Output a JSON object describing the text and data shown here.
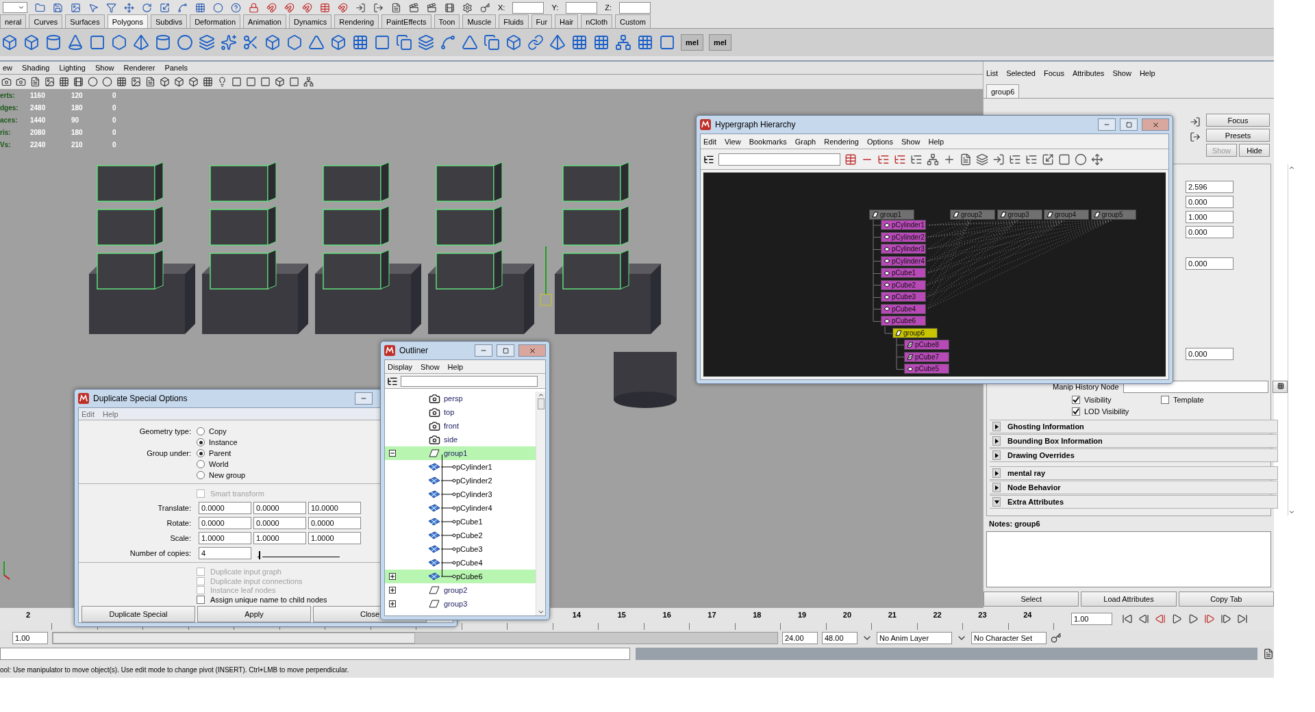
{
  "toolbar": {
    "coords": [
      "X:",
      "Y:",
      "Z:"
    ]
  },
  "shelf_tabs": [
    {
      "label": "neral",
      "selected": false
    },
    {
      "label": "Curves",
      "selected": false
    },
    {
      "label": "Surfaces",
      "selected": false
    },
    {
      "label": "Polygons",
      "selected": true
    },
    {
      "label": "Subdivs",
      "selected": false
    },
    {
      "label": "Deformation",
      "selected": false
    },
    {
      "label": "Animation",
      "selected": false
    },
    {
      "label": "Dynamics",
      "selected": false
    },
    {
      "label": "Rendering",
      "selected": false
    },
    {
      "label": "PaintEffects",
      "selected": false
    },
    {
      "label": "Toon",
      "selected": false
    },
    {
      "label": "Muscle",
      "selected": false
    },
    {
      "label": "Fluids",
      "selected": false
    },
    {
      "label": "Fur",
      "selected": false
    },
    {
      "label": "Hair",
      "selected": false
    },
    {
      "label": "nCloth",
      "selected": false
    },
    {
      "label": "Custom",
      "selected": false
    }
  ],
  "shelf_labels": [
    "mel",
    "mel"
  ],
  "panel_menu": [
    "ew",
    "Shading",
    "Lighting",
    "Show",
    "Renderer",
    "Panels"
  ],
  "hud": [
    {
      "label": "erts:",
      "values": [
        "1160",
        "120",
        "0"
      ]
    },
    {
      "label": "dges:",
      "values": [
        "2480",
        "180",
        "0"
      ]
    },
    {
      "label": "aces:",
      "values": [
        "1440",
        "90",
        "0"
      ]
    },
    {
      "label": "ris:",
      "values": [
        "2080",
        "180",
        "0"
      ]
    },
    {
      "label": "Vs:",
      "values": [
        "2240",
        "210",
        "0"
      ]
    }
  ],
  "attribute_editor": {
    "menus": [
      "List",
      "Selected",
      "Focus",
      "Attributes",
      "Show",
      "Help"
    ],
    "tabs": [
      {
        "label": "group6",
        "selected": true
      }
    ],
    "buttons": [
      {
        "label": "Focus",
        "disabled": false
      },
      {
        "label": "Presets",
        "disabled": false
      },
      {
        "label": "Show",
        "disabled": true
      },
      {
        "label": "Hide",
        "disabled": false
      }
    ],
    "fields": [
      "2.596",
      "0.000",
      "1.000",
      "0.000",
      "0.000",
      "0.000"
    ],
    "manip_label": "Manip History Node",
    "checks": [
      {
        "label": "Visibility",
        "checked": true
      },
      {
        "label": "Template",
        "checked": false
      },
      {
        "label": "LOD Visibility",
        "checked": true
      }
    ],
    "sections": [
      {
        "label": "Ghosting Information",
        "expanded": false
      },
      {
        "label": "Bounding Box Information",
        "expanded": false
      },
      {
        "label": "Drawing Overrides",
        "expanded": false
      },
      {
        "label": "mental ray",
        "expanded": false
      },
      {
        "label": "Node Behavior",
        "expanded": false
      },
      {
        "label": "Extra Attributes",
        "expanded": true
      }
    ],
    "notes": {
      "label": "Notes:  group6"
    },
    "bottom_buttons": [
      "Select",
      "Load Attributes",
      "Copy Tab"
    ]
  },
  "timeline": {
    "frames": [
      "2",
      "14",
      "15",
      "16",
      "17",
      "18",
      "19",
      "20",
      "21",
      "22",
      "23",
      "24"
    ],
    "current_frame": "1.00"
  },
  "range": {
    "start": "1.00",
    "end": "24.00",
    "max": "48.00",
    "anim_layer": "No Anim Layer",
    "character_set": "No Character Set",
    "level": 0.5
  },
  "help_line": "ool: Use manipulator to move object(s). Use edit mode to change pivot (INSERT).  Ctrl+LMB to move perpendicular.",
  "duplicate_dialog": {
    "title": "Duplicate Special Options",
    "menus": [
      "Edit",
      "Help"
    ],
    "radio_groups": [
      {
        "label": "Geometry type:",
        "options": [
          {
            "label": "Copy",
            "selected": false
          },
          {
            "label": "Instance",
            "selected": true
          }
        ]
      },
      {
        "label": "Group under:",
        "options": [
          {
            "label": "Parent",
            "selected": true
          },
          {
            "label": "World",
            "selected": false
          },
          {
            "label": "New group",
            "selected": false
          }
        ]
      }
    ],
    "smart_transform": {
      "label": "Smart transform",
      "checked": false,
      "disabled": true
    },
    "vectors": [
      {
        "label": "Translate:",
        "values": [
          "0.0000",
          "0.0000",
          "10.0000"
        ]
      },
      {
        "label": "Rotate:",
        "values": [
          "0.0000",
          "0.0000",
          "0.0000"
        ]
      },
      {
        "label": "Scale:",
        "values": [
          "1.0000",
          "1.0000",
          "1.0000"
        ]
      }
    ],
    "copies": {
      "label": "Number of copies:",
      "value": "4",
      "level": 0.02
    },
    "options": [
      {
        "label": "Duplicate input graph",
        "checked": false,
        "disabled": true
      },
      {
        "label": "Duplicate input connections",
        "checked": false,
        "disabled": true
      },
      {
        "label": "Instance leaf nodes",
        "checked": false,
        "disabled": true
      },
      {
        "label": "Assign unique name to child nodes",
        "checked": false,
        "disabled": false
      }
    ],
    "buttons": [
      "Duplicate Special",
      "Apply",
      "Close"
    ]
  },
  "outliner": {
    "title": "Outliner",
    "menus": [
      "Display",
      "Show",
      "Help"
    ],
    "items": [
      {
        "name": "persp",
        "kind": "camera",
        "selected": false
      },
      {
        "name": "top",
        "kind": "camera",
        "selected": false
      },
      {
        "name": "front",
        "kind": "camera",
        "selected": false
      },
      {
        "name": "side",
        "kind": "camera",
        "selected": false
      },
      {
        "name": "group1",
        "kind": "group",
        "selected": true,
        "expanded": true,
        "children": [
          {
            "name": "pCylinder1",
            "kind": "mesh",
            "selected": false
          },
          {
            "name": "pCylinder2",
            "kind": "mesh",
            "selected": false
          },
          {
            "name": "pCylinder3",
            "kind": "mesh",
            "selected": false
          },
          {
            "name": "pCylinder4",
            "kind": "mesh",
            "selected": false
          },
          {
            "name": "pCube1",
            "kind": "mesh",
            "selected": false
          },
          {
            "name": "pCube2",
            "kind": "mesh",
            "selected": false
          },
          {
            "name": "pCube3",
            "kind": "mesh",
            "selected": false
          },
          {
            "name": "pCube4",
            "kind": "mesh",
            "selected": false
          },
          {
            "name": "pCube6",
            "kind": "mesh",
            "selected": true,
            "expanded": false
          }
        ]
      },
      {
        "name": "group2",
        "kind": "group",
        "selected": false,
        "expanded": false
      },
      {
        "name": "group3",
        "kind": "group",
        "selected": false,
        "expanded": false
      }
    ]
  },
  "hypergraph": {
    "title": "Hypergraph Hierarchy",
    "menus": [
      "Edit",
      "View",
      "Bookmarks",
      "Graph",
      "Rendering",
      "Options",
      "Show",
      "Help"
    ],
    "nodes": [
      {
        "name": "group1",
        "kind": "group",
        "selected": false,
        "children": [
          {
            "name": "pCylinder1",
            "kind": "mesh",
            "selected": false
          },
          {
            "name": "pCylinder2",
            "kind": "mesh",
            "selected": false
          },
          {
            "name": "pCylinder3",
            "kind": "mesh",
            "selected": false
          },
          {
            "name": "pCylinder4",
            "kind": "mesh",
            "selected": false
          },
          {
            "name": "pCube1",
            "kind": "mesh",
            "selected": false
          },
          {
            "name": "pCube2",
            "kind": "mesh",
            "selected": false
          },
          {
            "name": "pCube3",
            "kind": "mesh",
            "selected": false
          },
          {
            "name": "pCube4",
            "kind": "mesh",
            "selected": false
          },
          {
            "name": "pCube6",
            "kind": "mesh",
            "selected": false,
            "children": [
              {
                "name": "group6",
                "kind": "group",
                "selected": true,
                "children": [
                  {
                    "name": "pCube8",
                    "kind": "instance",
                    "selected": false
                  },
                  {
                    "name": "pCube7",
                    "kind": "instance",
                    "selected": false
                  },
                  {
                    "name": "pCube5",
                    "kind": "mesh",
                    "selected": false
                  }
                ]
              }
            ]
          }
        ]
      },
      {
        "name": "group2",
        "kind": "group",
        "selected": false
      },
      {
        "name": "group3",
        "kind": "group",
        "selected": false
      },
      {
        "name": "group4",
        "kind": "group",
        "selected": false
      },
      {
        "name": "group5",
        "kind": "group",
        "selected": false
      }
    ]
  }
}
